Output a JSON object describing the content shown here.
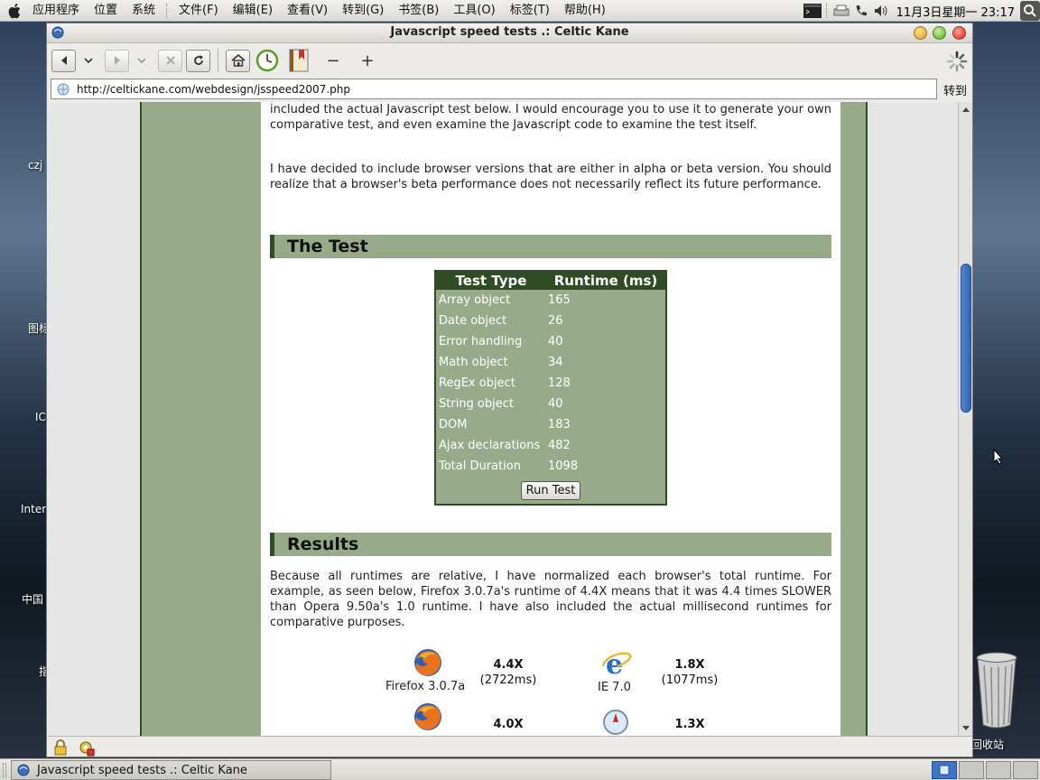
{
  "top_panel": {
    "menus": [
      "应用程序",
      "位置",
      "系统"
    ],
    "app_menus": [
      "文件(F)",
      "编辑(E)",
      "查看(V)",
      "转到(G)",
      "书签(B)",
      "工具(O)",
      "标签(T)",
      "帮助(H)"
    ],
    "clock": "11月3日星期一 23:17"
  },
  "desktop": {
    "labels": [
      "czj",
      "图标",
      "IC",
      "Inter",
      "中国",
      "指"
    ],
    "trash_label": "回收站"
  },
  "window": {
    "title": "Javascript speed tests .: Celtic Kane",
    "url": "http://celtickane.com/webdesign/jsspeed2007.php",
    "goto_label": "转到",
    "zoom_out": "−",
    "zoom_in": "+"
  },
  "page": {
    "intro_1": "included the actual Javascript test below. I would encourage you to use it to generate your own comparative test, and even examine the Javascript code to examine the test itself.",
    "intro_2": "I have decided to include browser versions that are either in alpha or beta version. You should realize that a browser's beta performance does not necessarily reflect its future performance.",
    "test_heading": "The Test",
    "results_heading": "Results",
    "results_text": "Because all runtimes are relative, I have normalized each browser's total runtime. For example, as seen below, Firefox 3.0.7a's runtime of 4.4X means that it was 4.4 times SLOWER than Opera 9.50a's 1.0 runtime. I have also included the actual millisecond runtimes for comparative purposes.",
    "test_table": {
      "headers": [
        "Test Type",
        "Runtime (ms)"
      ],
      "rows": [
        [
          "Array object",
          "165"
        ],
        [
          "Date object",
          "26"
        ],
        [
          "Error handling",
          "40"
        ],
        [
          "Math object",
          "34"
        ],
        [
          "RegEx object",
          "128"
        ],
        [
          "String object",
          "40"
        ],
        [
          "DOM",
          "183"
        ],
        [
          "Ajax declarations",
          "482"
        ],
        [
          "Total Duration",
          "1098"
        ]
      ],
      "button": "Run Test"
    },
    "browsers": [
      {
        "name": "Firefox 3.0.7a",
        "factor": "4.4X",
        "ms": "(2722ms)",
        "icon": "firefox-icon"
      },
      {
        "name": "IE 7.0",
        "factor": "1.8X",
        "ms": "(1077ms)",
        "icon": "ie-icon"
      },
      {
        "name": "",
        "factor": "4.0X",
        "ms": "",
        "icon": "firefox-icon"
      },
      {
        "name": "",
        "factor": "1.3X",
        "ms": "",
        "icon": "safari-icon"
      }
    ]
  },
  "taskbar": {
    "window_button": "Javascript speed tests .: Celtic Kane"
  }
}
